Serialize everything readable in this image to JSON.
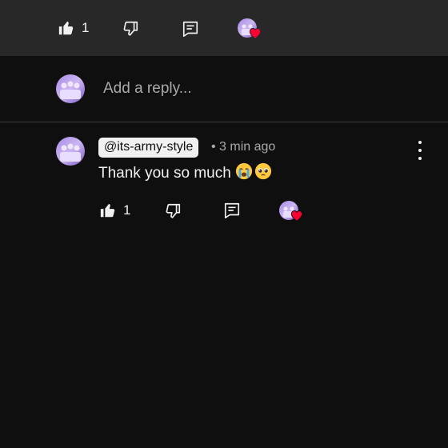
{
  "top_actions": {
    "like_count": "1",
    "like_icon": "thumbs-up-filled-icon",
    "dislike_icon": "thumbs-down-icon",
    "reply_icon": "comment-icon",
    "creator_heart_icon": "heart-icon"
  },
  "reply_box": {
    "placeholder": "Add a reply..."
  },
  "comment": {
    "handle": "@its-army-style",
    "timestamp": "• 3 min ago",
    "text": "Thank you so much",
    "emojis": [
      "loudly-crying-face",
      "pleading-face"
    ],
    "like_count": "1",
    "more_icon": "more-vertical-icon"
  },
  "colors": {
    "background": "#0f0f0f",
    "top_bar": "#282828",
    "text": "#f1f1f1",
    "muted_text": "#aaaaaa",
    "heart": "#ff0033",
    "avatar_purple": "#8e6bd1"
  }
}
